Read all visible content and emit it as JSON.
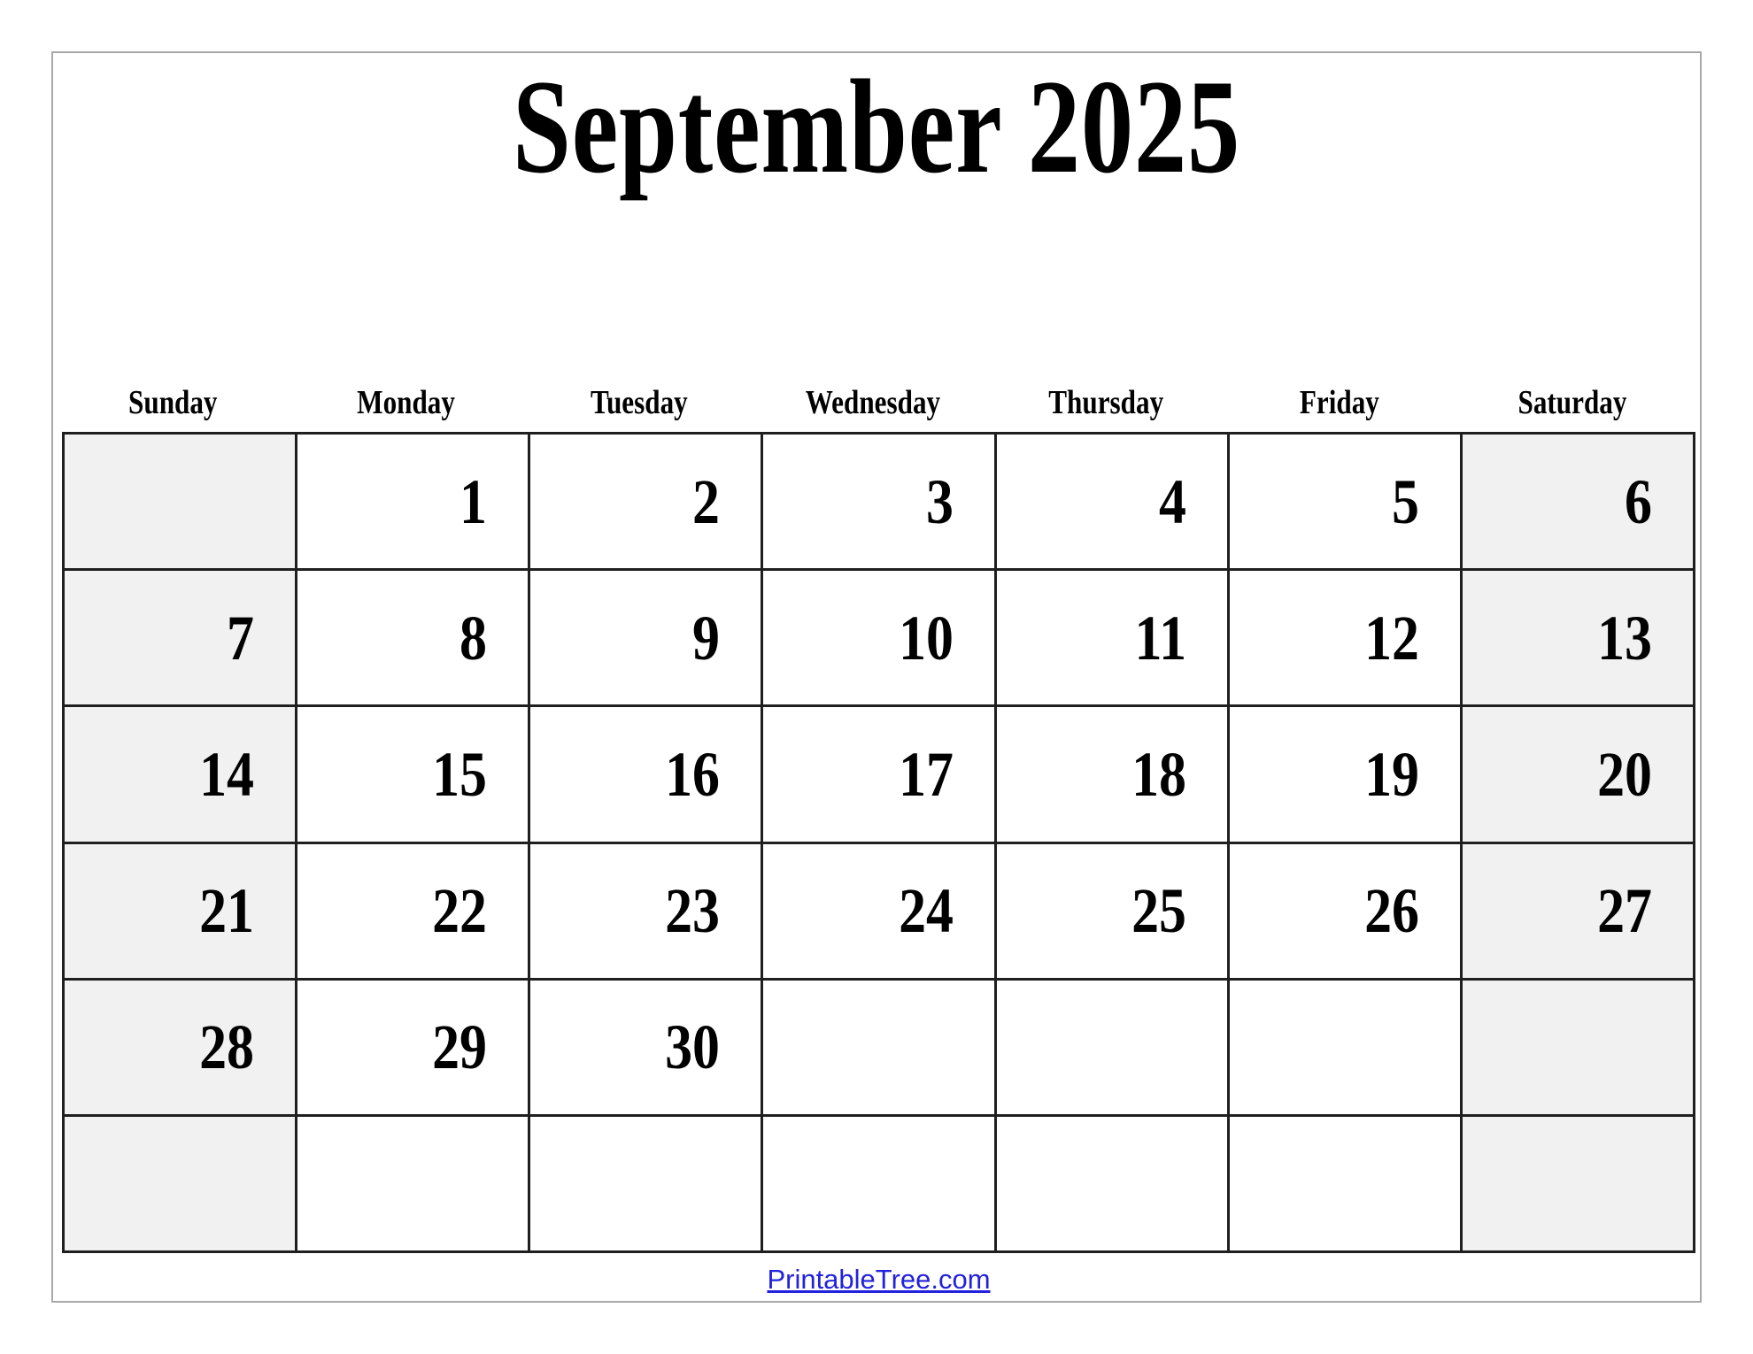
{
  "page": {
    "title": "September 2025",
    "background_color": "#ffffff",
    "frame_border_color": "#a8a8a8"
  },
  "calendar": {
    "month": "September",
    "year": "2025",
    "title": "September 2025",
    "grid_border_color": "#1f1f1f",
    "weekend_cell_color": "#f1f1f1",
    "weekday_cell_color": "#ffffff",
    "weekday_headers": [
      {
        "label": "Sunday",
        "weekend": true
      },
      {
        "label": "Monday",
        "weekend": false
      },
      {
        "label": "Tuesday",
        "weekend": false
      },
      {
        "label": "Wednesday",
        "weekend": false
      },
      {
        "label": "Thursday",
        "weekend": false
      },
      {
        "label": "Friday",
        "weekend": false
      },
      {
        "label": "Saturday",
        "weekend": true
      }
    ],
    "weeks": [
      [
        {
          "day": "",
          "weekend": true
        },
        {
          "day": "1",
          "weekend": false
        },
        {
          "day": "2",
          "weekend": false
        },
        {
          "day": "3",
          "weekend": false
        },
        {
          "day": "4",
          "weekend": false
        },
        {
          "day": "5",
          "weekend": false
        },
        {
          "day": "6",
          "weekend": true
        }
      ],
      [
        {
          "day": "7",
          "weekend": true
        },
        {
          "day": "8",
          "weekend": false
        },
        {
          "day": "9",
          "weekend": false
        },
        {
          "day": "10",
          "weekend": false
        },
        {
          "day": "11",
          "weekend": false
        },
        {
          "day": "12",
          "weekend": false
        },
        {
          "day": "13",
          "weekend": true
        }
      ],
      [
        {
          "day": "14",
          "weekend": true
        },
        {
          "day": "15",
          "weekend": false
        },
        {
          "day": "16",
          "weekend": false
        },
        {
          "day": "17",
          "weekend": false
        },
        {
          "day": "18",
          "weekend": false
        },
        {
          "day": "19",
          "weekend": false
        },
        {
          "day": "20",
          "weekend": true
        }
      ],
      [
        {
          "day": "21",
          "weekend": true
        },
        {
          "day": "22",
          "weekend": false
        },
        {
          "day": "23",
          "weekend": false
        },
        {
          "day": "24",
          "weekend": false
        },
        {
          "day": "25",
          "weekend": false
        },
        {
          "day": "26",
          "weekend": false
        },
        {
          "day": "27",
          "weekend": true
        }
      ],
      [
        {
          "day": "28",
          "weekend": true
        },
        {
          "day": "29",
          "weekend": false
        },
        {
          "day": "30",
          "weekend": false
        },
        {
          "day": "",
          "weekend": false
        },
        {
          "day": "",
          "weekend": false
        },
        {
          "day": "",
          "weekend": false
        },
        {
          "day": "",
          "weekend": true
        }
      ],
      [
        {
          "day": "",
          "weekend": true
        },
        {
          "day": "",
          "weekend": false
        },
        {
          "day": "",
          "weekend": false
        },
        {
          "day": "",
          "weekend": false
        },
        {
          "day": "",
          "weekend": false
        },
        {
          "day": "",
          "weekend": false
        },
        {
          "day": "",
          "weekend": true
        }
      ]
    ]
  },
  "footer": {
    "link_text": "PrintableTree.com",
    "link_color": "#2222dd"
  }
}
